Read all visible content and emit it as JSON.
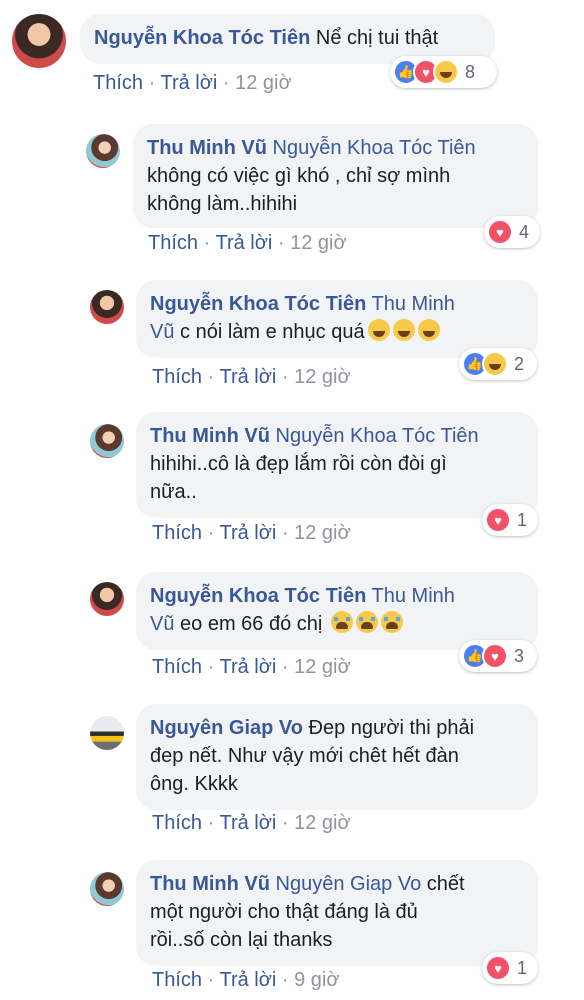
{
  "comments": [
    {
      "author": "Nguyễn Khoa Tóc Tiên",
      "mention": "",
      "text1": "Nể chị tui thật",
      "text2": "",
      "text3": "",
      "emojis": [],
      "reactions": [
        "like",
        "love",
        "haha"
      ],
      "reaction_count": "8",
      "like_label": "Thích",
      "reply_label": "Trả lời",
      "time": "12 giờ"
    },
    {
      "author": "Thu Minh Vũ",
      "mention": "Nguyễn Khoa Tóc Tiên",
      "text1": "không có việc gì khó , chỉ sợ mình",
      "text2": "không làm..hihihi",
      "reactions": [
        "love"
      ],
      "reaction_count": "4",
      "like_label": "Thích",
      "reply_label": "Trả lời",
      "time": "12 giờ"
    },
    {
      "author": "Nguyễn Khoa Tóc Tiên",
      "mention": "Thu Minh",
      "mention2": "Vũ",
      "text1": "c nói làm e nhục quá",
      "emojis": [
        "laugh-cry",
        "laugh-cry",
        "laugh-cry"
      ],
      "reactions": [
        "like",
        "haha"
      ],
      "reaction_count": "2",
      "like_label": "Thích",
      "reply_label": "Trả lời",
      "time": "12 giờ"
    },
    {
      "author": "Thu Minh Vũ",
      "mention": "Nguyễn Khoa Tóc Tiên",
      "text1": "hihihi..cô là đẹp lắm rồi còn đòi gì",
      "text2": "nữa..",
      "reactions": [
        "love"
      ],
      "reaction_count": "1",
      "like_label": "Thích",
      "reply_label": "Trả lời",
      "time": "12 giờ"
    },
    {
      "author": "Nguyễn Khoa Tóc Tiên",
      "mention": "Thu Minh",
      "mention2": "Vũ",
      "text1": "eo em 66 đó chị",
      "emojis": [
        "crying",
        "crying",
        "crying"
      ],
      "reactions": [
        "like",
        "love"
      ],
      "reaction_count": "3",
      "like_label": "Thích",
      "reply_label": "Trả lời",
      "time": "12 giờ"
    },
    {
      "author": "Nguyên Giap Vo",
      "mention": "",
      "text1": "Đep người thi phải",
      "text2": "đep nết. Như vậy mới chêt hết đàn",
      "text3": "ông. Kkkk",
      "reactions": [],
      "reaction_count": "",
      "like_label": "Thích",
      "reply_label": "Trả lời",
      "time": "12 giờ"
    },
    {
      "author": "Thu Minh Vũ",
      "mention": "Nguyên Giap Vo",
      "text1": "chết",
      "text2": "một người cho thật đáng là đủ",
      "text3": "rồi..số còn lại thanks",
      "reactions": [
        "love"
      ],
      "reaction_count": "1",
      "like_label": "Thích",
      "reply_label": "Trả lời",
      "time": "9 giờ"
    }
  ],
  "separator": "·",
  "colors": {
    "name": "#385898",
    "bubble": "#f2f3f5",
    "meta": "#90949c"
  }
}
